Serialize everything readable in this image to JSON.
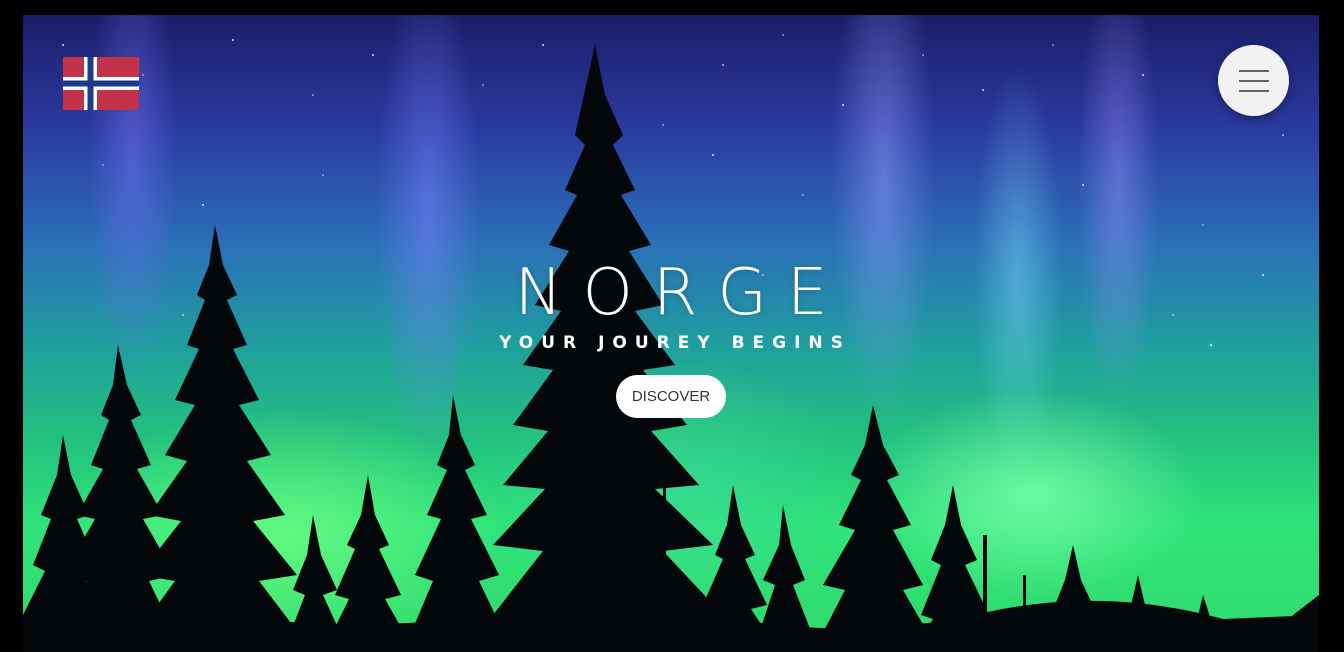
{
  "hero": {
    "title": "NORGE",
    "subtitle": "YOUR JOUREY BEGINS",
    "cta_label": "DISCOVER"
  },
  "header": {
    "logo": "norway-flag-icon",
    "menu_icon": "hamburger-menu-icon"
  },
  "colors": {
    "flag_red": "#c2334a",
    "flag_white": "#ffffff",
    "flag_blue": "#1e3a8a",
    "menu_bg": "#f2f2f2",
    "cta_bg": "#ffffff"
  }
}
